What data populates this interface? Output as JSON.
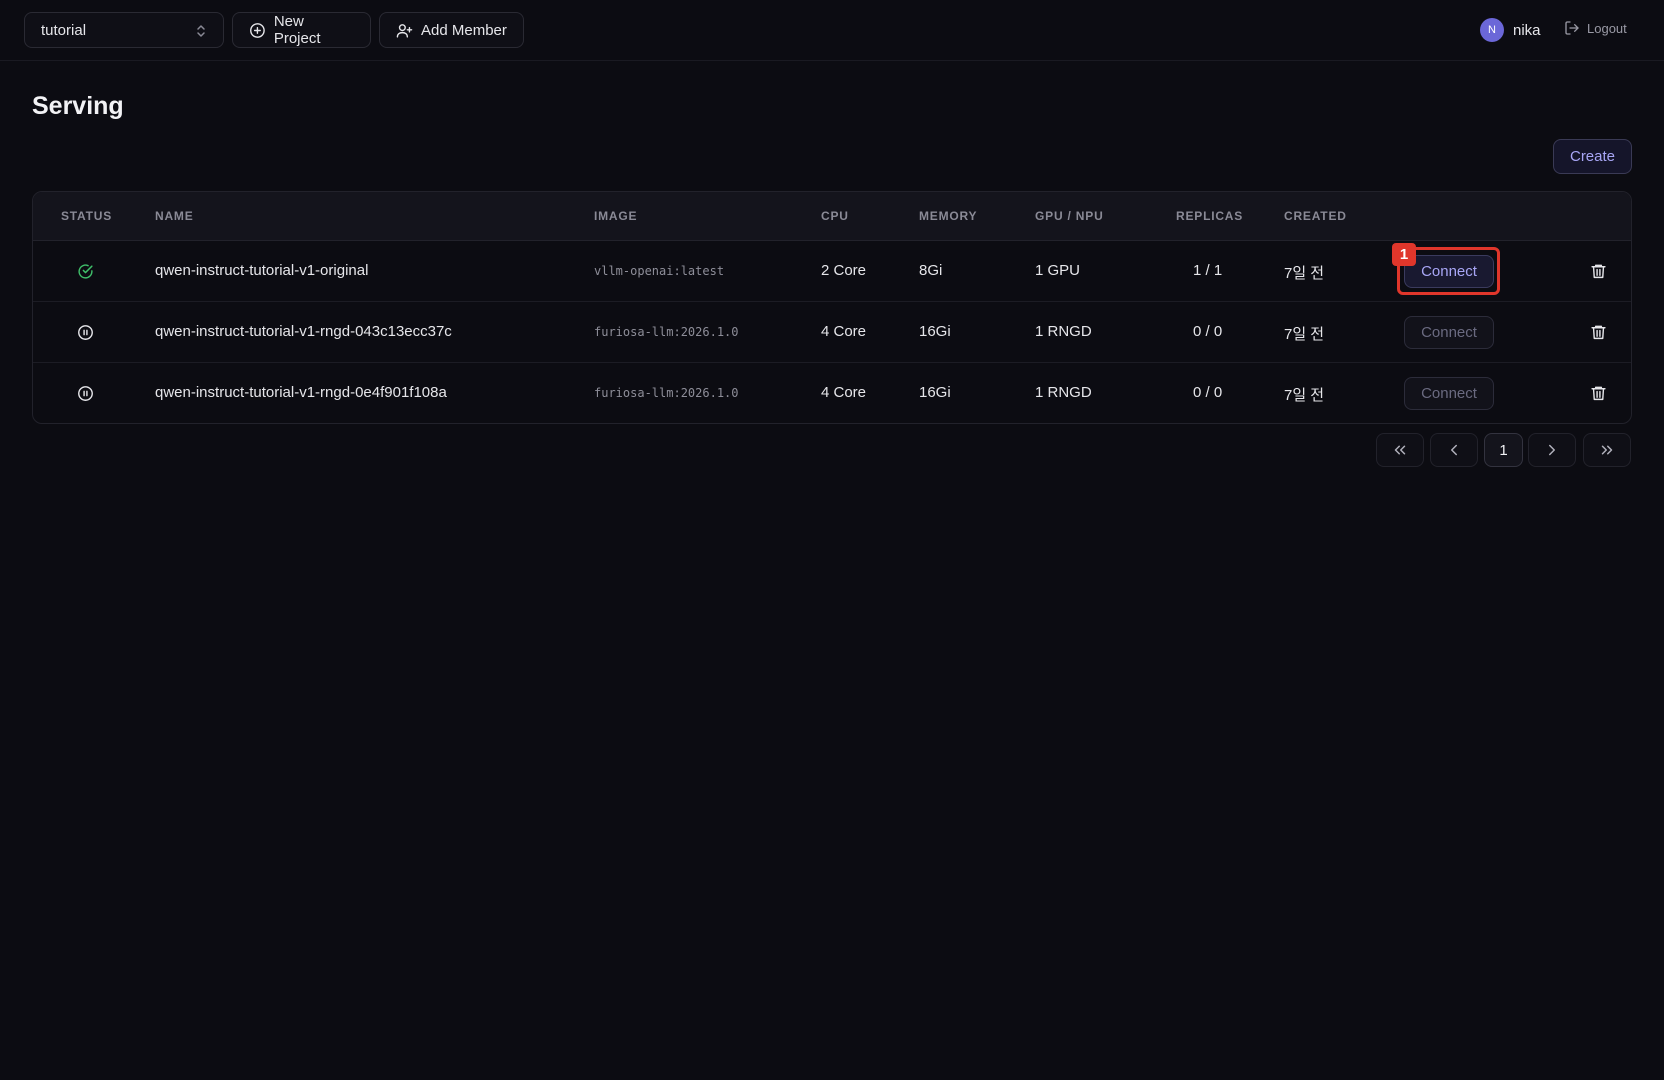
{
  "topbar": {
    "project_select": "tutorial",
    "new_project_label": "New Project",
    "add_member_label": "Add Member",
    "user": {
      "initial": "N",
      "name": "nika"
    },
    "logout_label": "Logout"
  },
  "page": {
    "title": "Serving",
    "create_label": "Create"
  },
  "table": {
    "headers": {
      "status": "STATUS",
      "name": "NAME",
      "image": "IMAGE",
      "cpu": "CPU",
      "memory": "MEMORY",
      "gpu": "GPU / NPU",
      "replicas": "REPLICAS",
      "created": "CREATED"
    },
    "rows": [
      {
        "status": "running",
        "name": "qwen-instruct-tutorial-v1-original",
        "image": "vllm-openai:latest",
        "cpu": "2 Core",
        "memory": "8Gi",
        "gpu": "1 GPU",
        "replicas": "1 / 1",
        "created": "7일 전",
        "connect_label": "Connect"
      },
      {
        "status": "paused",
        "name": "qwen-instruct-tutorial-v1-rngd-043c13ecc37c",
        "image": "furiosa-llm:2026.1.0",
        "cpu": "4 Core",
        "memory": "16Gi",
        "gpu": "1 RNGD",
        "replicas": "0 / 0",
        "created": "7일 전",
        "connect_label": "Connect"
      },
      {
        "status": "paused",
        "name": "qwen-instruct-tutorial-v1-rngd-0e4f901f108a",
        "image": "furiosa-llm:2026.1.0",
        "cpu": "4 Core",
        "memory": "16Gi",
        "gpu": "1 RNGD",
        "replicas": "0 / 0",
        "created": "7일 전",
        "connect_label": "Connect"
      }
    ]
  },
  "annotation": {
    "marker": "1"
  },
  "pagination": {
    "current_page": "1"
  },
  "colors": {
    "accent": "#a8a6f5",
    "status_running": "#3fbf6a",
    "highlight": "#e0362b"
  }
}
